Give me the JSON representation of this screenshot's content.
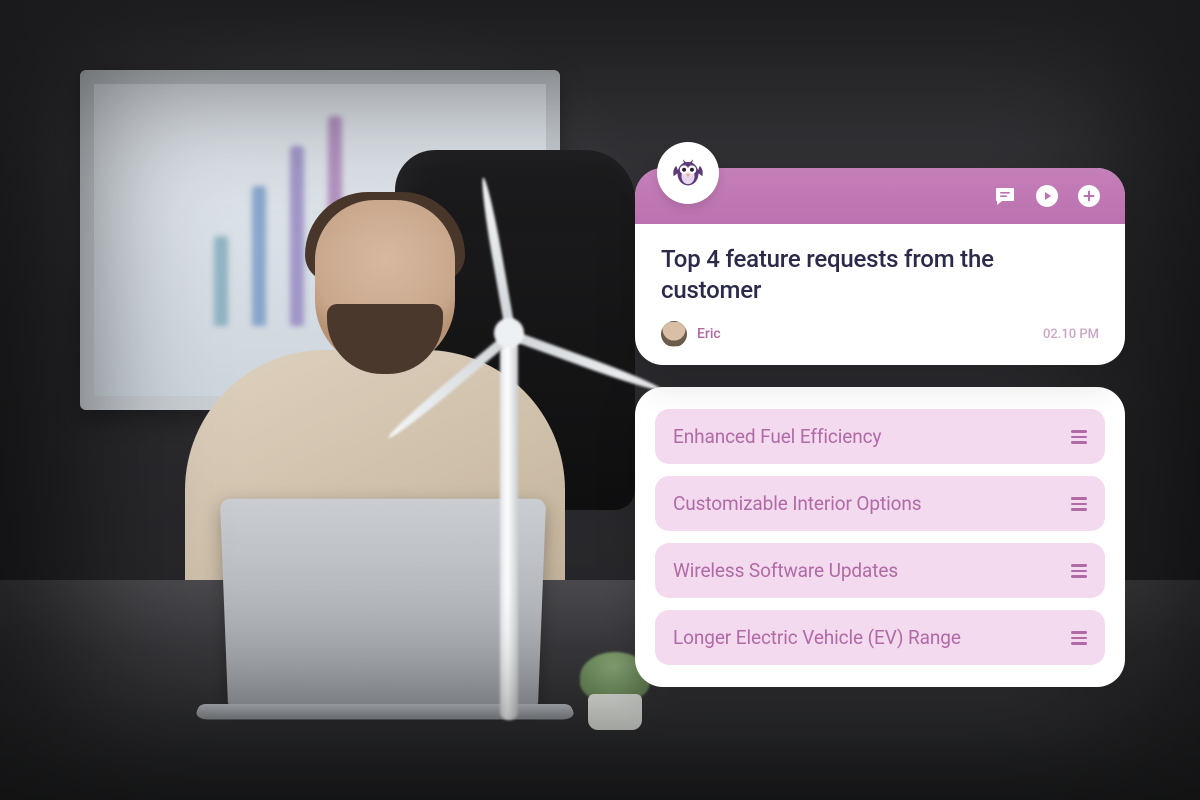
{
  "note": {
    "title": "Top 4 feature requests from the customer",
    "author": "Eric",
    "timestamp": "02.10 PM"
  },
  "features": [
    {
      "label": "Enhanced Fuel Efficiency"
    },
    {
      "label": "Customizable Interior Options"
    },
    {
      "label": "Wireless Software Updates"
    },
    {
      "label": "Longer Electric Vehicle (EV) Range"
    }
  ],
  "icons": {
    "logo": "owl-icon",
    "chat": "chat-icon",
    "media": "play-icon",
    "add": "plus-icon",
    "drag": "drag-handle-icon"
  },
  "colors": {
    "accent": "#bb72b0",
    "accent_text": "#b06aa5",
    "pill_bg": "#f4daee",
    "title_text": "#2c2a4a"
  }
}
